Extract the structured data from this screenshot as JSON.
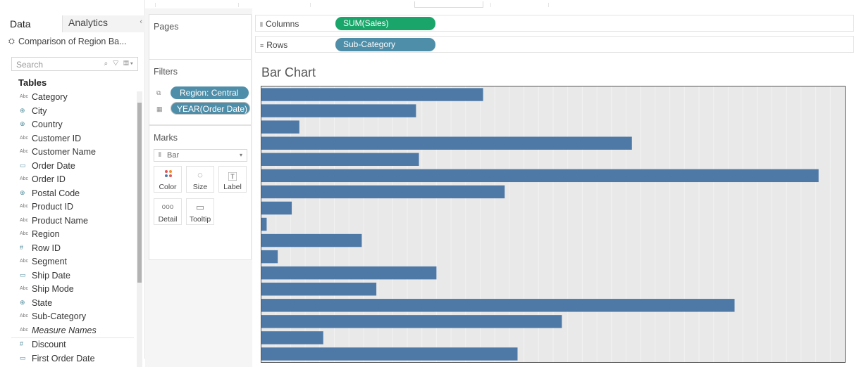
{
  "data_pane": {
    "tab_data": "Data",
    "tab_analytics": "Analytics",
    "collapse_glyph": "‹",
    "datasource": "Comparison of Region Ba...",
    "search_placeholder": "Search",
    "tables_heading": "Tables",
    "fields": [
      {
        "icon": "Abc",
        "label": "Category",
        "type": "text"
      },
      {
        "icon": "⊕",
        "label": "City",
        "type": "geo"
      },
      {
        "icon": "⊕",
        "label": "Country",
        "type": "geo"
      },
      {
        "icon": "Abc",
        "label": "Customer ID",
        "type": "text"
      },
      {
        "icon": "Abc",
        "label": "Customer Name",
        "type": "text"
      },
      {
        "icon": "▭",
        "label": "Order Date",
        "type": "date"
      },
      {
        "icon": "Abc",
        "label": "Order ID",
        "type": "text"
      },
      {
        "icon": "⊕",
        "label": "Postal Code",
        "type": "geo"
      },
      {
        "icon": "Abc",
        "label": "Product ID",
        "type": "text"
      },
      {
        "icon": "Abc",
        "label": "Product Name",
        "type": "text"
      },
      {
        "icon": "Abc",
        "label": "Region",
        "type": "text"
      },
      {
        "icon": "#",
        "label": "Row ID",
        "type": "num"
      },
      {
        "icon": "Abc",
        "label": "Segment",
        "type": "text"
      },
      {
        "icon": "▭",
        "label": "Ship Date",
        "type": "date"
      },
      {
        "icon": "Abc",
        "label": "Ship Mode",
        "type": "text"
      },
      {
        "icon": "⊕",
        "label": "State",
        "type": "geo"
      },
      {
        "icon": "Abc",
        "label": "Sub-Category",
        "type": "text"
      },
      {
        "icon": "Abc",
        "label": "Measure Names",
        "type": "text",
        "italic": true
      }
    ],
    "measures": [
      {
        "icon": "#",
        "label": "Discount",
        "type": "num"
      },
      {
        "icon": "▭",
        "label": "First Order Date",
        "type": "date"
      }
    ]
  },
  "pages": {
    "title": "Pages"
  },
  "filters": {
    "title": "Filters",
    "items": [
      "Region: Central",
      "YEAR(Order Date)"
    ]
  },
  "marks": {
    "title": "Marks",
    "mark_type": "Bar",
    "buttons": [
      "Color",
      "Size",
      "Label",
      "Detail",
      "Tooltip"
    ]
  },
  "shelves": {
    "columns_label": "Columns",
    "columns_pill": "SUM(Sales)",
    "rows_label": "Rows",
    "rows_pill": "Sub-Category"
  },
  "colors": {
    "measure_pill": "#1aa56a",
    "dimension_pill": "#4f8ea8",
    "bar": "#4e79a7"
  },
  "chart_data": {
    "type": "bar",
    "orientation": "horizontal",
    "title": "Bar Chart",
    "values": [
      38,
      26.5,
      6.5,
      63.5,
      27,
      95.5,
      41.7,
      5.2,
      0.9,
      17.2,
      2.8,
      30,
      19.7,
      81.1,
      51.5,
      10.6,
      43.9
    ],
    "xlim": [
      0,
      100
    ],
    "grid": true
  }
}
